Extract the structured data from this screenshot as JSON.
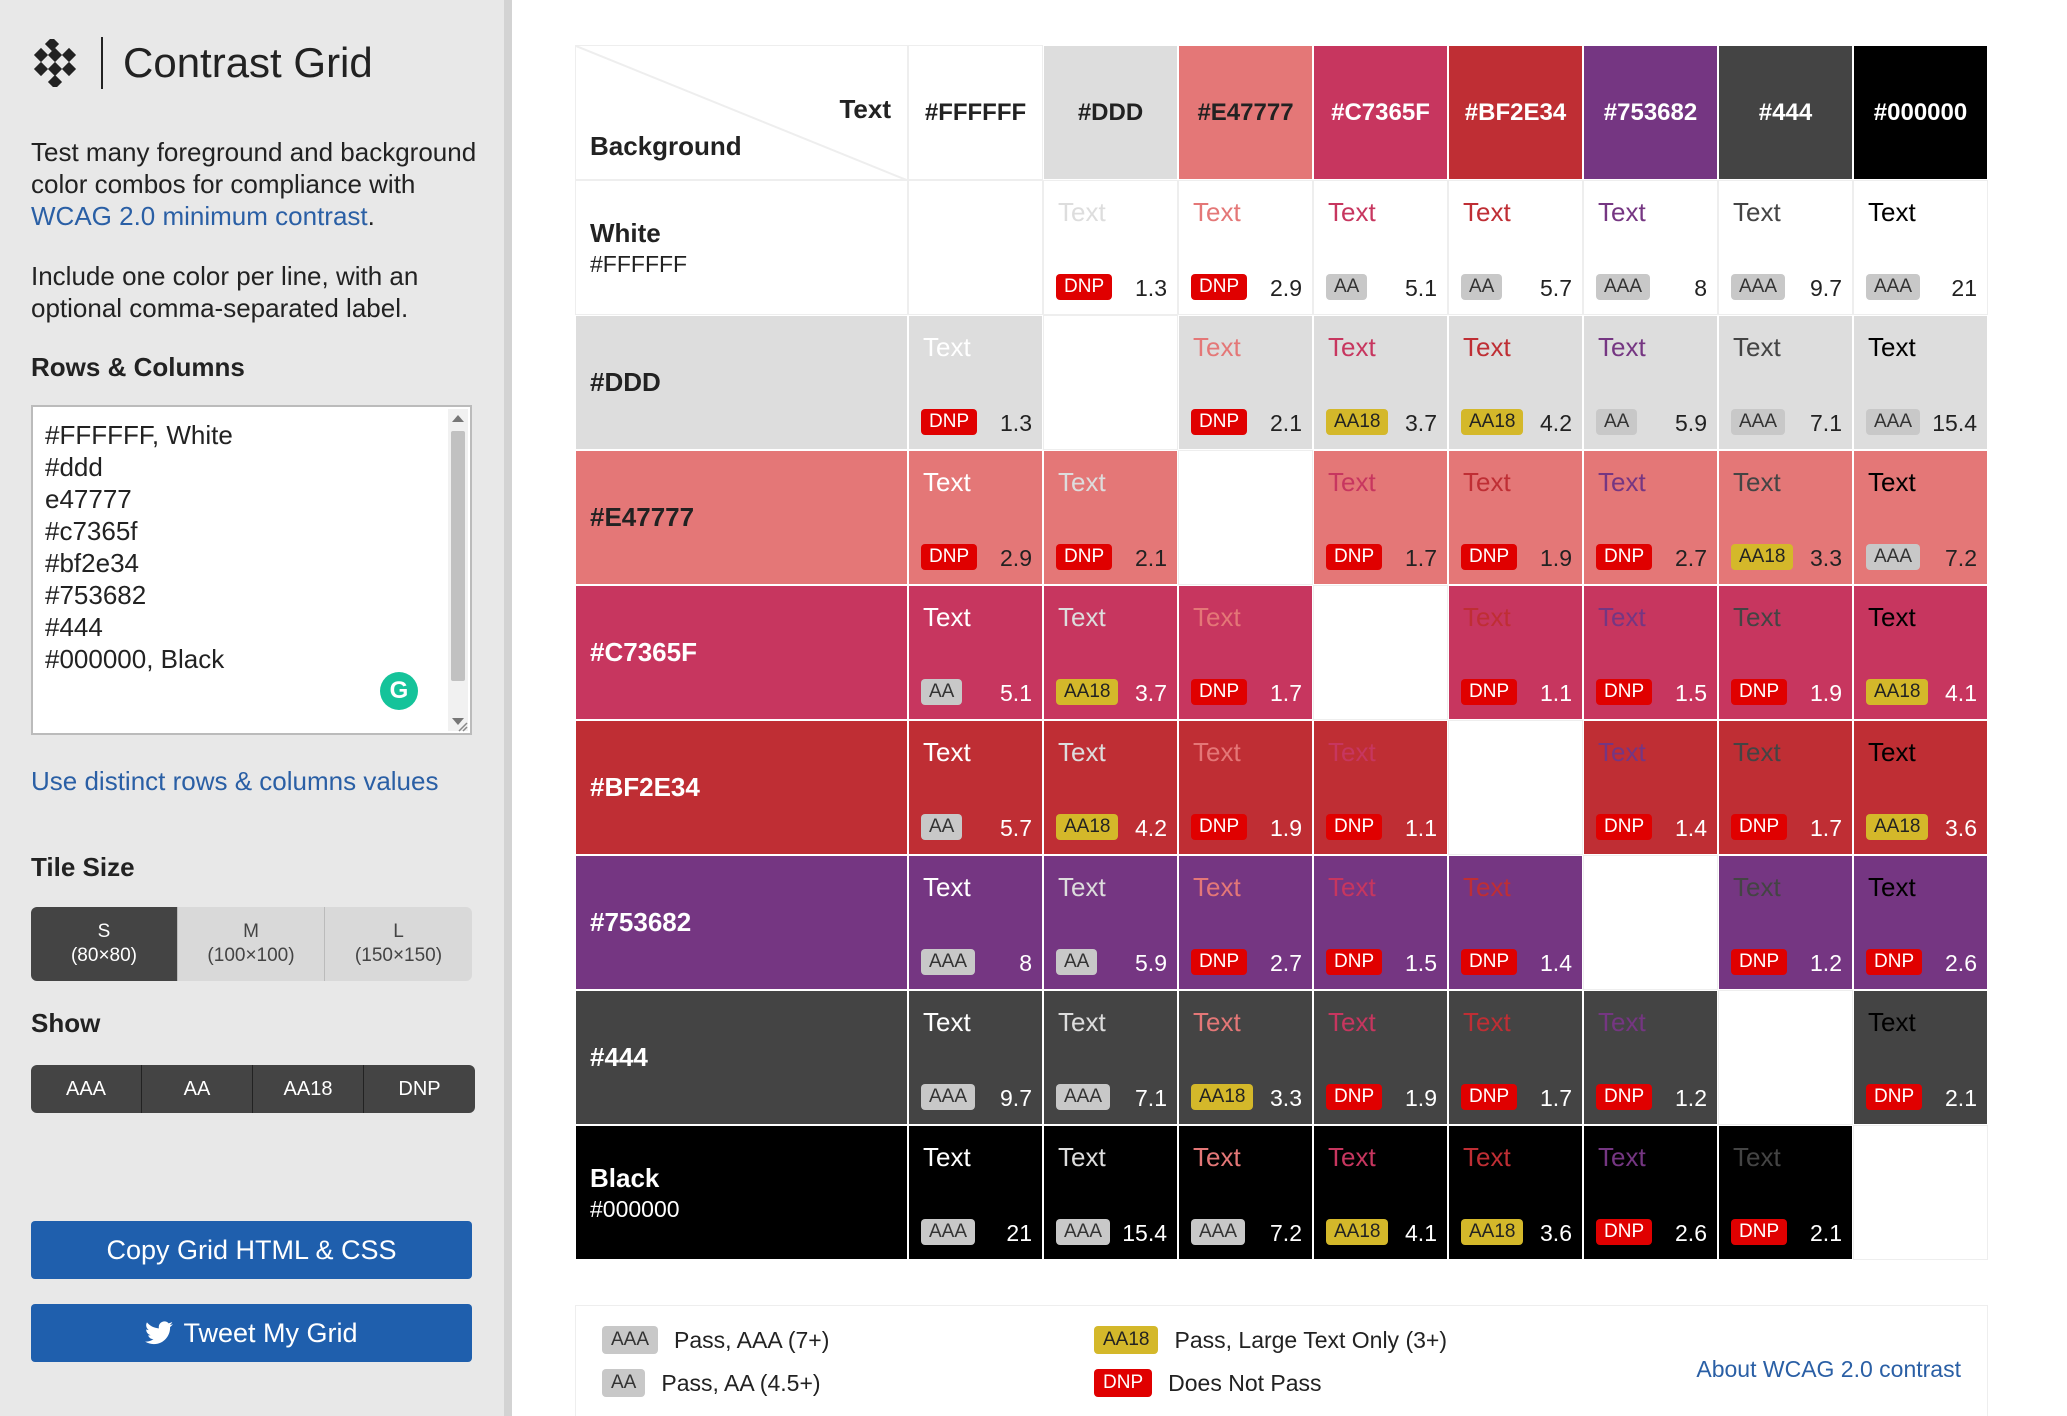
{
  "app": {
    "title": "Contrast Grid"
  },
  "sidebar": {
    "description_before": "Test many foreground and background color combos for compliance with ",
    "description_link": "WCAG 2.0 minimum contrast",
    "description_after": ".",
    "instructions": "Include one color per line, with an optional comma-separated label.",
    "rows_columns_label": "Rows & Columns",
    "color_input_value": "#FFFFFF, White\n#ddd\ne47777\n#c7365f\n#bf2e34\n#753682\n#444\n#000000, Black",
    "distinct_link": "Use distinct rows & columns values",
    "tile_size_label": "Tile Size",
    "tile_sizes": [
      {
        "name": "S",
        "dim": "(80×80)",
        "active": true
      },
      {
        "name": "M",
        "dim": "(100×100)",
        "active": false
      },
      {
        "name": "L",
        "dim": "(150×150)",
        "active": false
      }
    ],
    "show_label": "Show",
    "show_options": [
      "AAA",
      "AA",
      "AA18",
      "DNP"
    ],
    "copy_button": "Copy Grid HTML & CSS",
    "tweet_button": "Tweet My Grid"
  },
  "grid": {
    "corner_text": "Text",
    "corner_background": "Background",
    "sample_text": "Text",
    "columns": [
      {
        "label": "#FFFFFF",
        "color": "#FFFFFF",
        "label_color": "#222222"
      },
      {
        "label": "#DDD",
        "color": "#DDDDDD",
        "label_color": "#222222"
      },
      {
        "label": "#E47777",
        "color": "#E47777",
        "label_color": "#222222"
      },
      {
        "label": "#C7365F",
        "color": "#C7365F",
        "label_color": "#FFFFFF"
      },
      {
        "label": "#BF2E34",
        "color": "#BF2E34",
        "label_color": "#FFFFFF"
      },
      {
        "label": "#753682",
        "color": "#753682",
        "label_color": "#FFFFFF"
      },
      {
        "label": "#444",
        "color": "#444444",
        "label_color": "#FFFFFF"
      },
      {
        "label": "#000000",
        "color": "#000000",
        "label_color": "#FFFFFF"
      }
    ],
    "rows": [
      {
        "name": "White",
        "hex": "#FFFFFF",
        "color": "#FFFFFF",
        "label_color": "#222222",
        "cells": [
          null,
          {
            "b": "DNP",
            "r": "1.3"
          },
          {
            "b": "DNP",
            "r": "2.9"
          },
          {
            "b": "AA",
            "r": "5.1"
          },
          {
            "b": "AA",
            "r": "5.7"
          },
          {
            "b": "AAA",
            "r": "8"
          },
          {
            "b": "AAA",
            "r": "9.7"
          },
          {
            "b": "AAA",
            "r": "21"
          }
        ]
      },
      {
        "name": "#DDD",
        "hex": "",
        "color": "#DDDDDD",
        "label_color": "#222222",
        "cells": [
          {
            "b": "DNP",
            "r": "1.3"
          },
          null,
          {
            "b": "DNP",
            "r": "2.1"
          },
          {
            "b": "AA18",
            "r": "3.7"
          },
          {
            "b": "AA18",
            "r": "4.2"
          },
          {
            "b": "AA",
            "r": "5.9"
          },
          {
            "b": "AAA",
            "r": "7.1"
          },
          {
            "b": "AAA",
            "r": "15.4"
          }
        ]
      },
      {
        "name": "#E47777",
        "hex": "",
        "color": "#E47777",
        "label_color": "#222222",
        "cells": [
          {
            "b": "DNP",
            "r": "2.9"
          },
          {
            "b": "DNP",
            "r": "2.1"
          },
          null,
          {
            "b": "DNP",
            "r": "1.7"
          },
          {
            "b": "DNP",
            "r": "1.9"
          },
          {
            "b": "DNP",
            "r": "2.7"
          },
          {
            "b": "AA18",
            "r": "3.3"
          },
          {
            "b": "AAA",
            "r": "7.2"
          }
        ]
      },
      {
        "name": "#C7365F",
        "hex": "",
        "color": "#C7365F",
        "label_color": "#FFFFFF",
        "cells": [
          {
            "b": "AA",
            "r": "5.1"
          },
          {
            "b": "AA18",
            "r": "3.7"
          },
          {
            "b": "DNP",
            "r": "1.7"
          },
          null,
          {
            "b": "DNP",
            "r": "1.1"
          },
          {
            "b": "DNP",
            "r": "1.5"
          },
          {
            "b": "DNP",
            "r": "1.9"
          },
          {
            "b": "AA18",
            "r": "4.1"
          }
        ]
      },
      {
        "name": "#BF2E34",
        "hex": "",
        "color": "#BF2E34",
        "label_color": "#FFFFFF",
        "cells": [
          {
            "b": "AA",
            "r": "5.7"
          },
          {
            "b": "AA18",
            "r": "4.2"
          },
          {
            "b": "DNP",
            "r": "1.9"
          },
          {
            "b": "DNP",
            "r": "1.1"
          },
          null,
          {
            "b": "DNP",
            "r": "1.4"
          },
          {
            "b": "DNP",
            "r": "1.7"
          },
          {
            "b": "AA18",
            "r": "3.6"
          }
        ]
      },
      {
        "name": "#753682",
        "hex": "",
        "color": "#753682",
        "label_color": "#FFFFFF",
        "cells": [
          {
            "b": "AAA",
            "r": "8"
          },
          {
            "b": "AA",
            "r": "5.9"
          },
          {
            "b": "DNP",
            "r": "2.7"
          },
          {
            "b": "DNP",
            "r": "1.5"
          },
          {
            "b": "DNP",
            "r": "1.4"
          },
          null,
          {
            "b": "DNP",
            "r": "1.2"
          },
          {
            "b": "DNP",
            "r": "2.6"
          }
        ]
      },
      {
        "name": "#444",
        "hex": "",
        "color": "#444444",
        "label_color": "#FFFFFF",
        "cells": [
          {
            "b": "AAA",
            "r": "9.7"
          },
          {
            "b": "AAA",
            "r": "7.1"
          },
          {
            "b": "AA18",
            "r": "3.3"
          },
          {
            "b": "DNP",
            "r": "1.9"
          },
          {
            "b": "DNP",
            "r": "1.7"
          },
          {
            "b": "DNP",
            "r": "1.2"
          },
          null,
          {
            "b": "DNP",
            "r": "2.1"
          }
        ]
      },
      {
        "name": "Black",
        "hex": "#000000",
        "color": "#000000",
        "label_color": "#FFFFFF",
        "cells": [
          {
            "b": "AAA",
            "r": "21"
          },
          {
            "b": "AAA",
            "r": "15.4"
          },
          {
            "b": "AAA",
            "r": "7.2"
          },
          {
            "b": "AA18",
            "r": "4.1"
          },
          {
            "b": "AA18",
            "r": "3.6"
          },
          {
            "b": "DNP",
            "r": "2.6"
          },
          {
            "b": "DNP",
            "r": "2.1"
          },
          null
        ]
      }
    ]
  },
  "legend": {
    "items": [
      {
        "badge": "AAA",
        "text": "Pass, AAA (7+)"
      },
      {
        "badge": "AA",
        "text": "Pass, AA (4.5+)"
      },
      {
        "badge": "AA18",
        "text": "Pass, Large Text Only (3+)"
      },
      {
        "badge": "DNP",
        "text": "Does Not Pass"
      }
    ],
    "about_link": "About WCAG 2.0 contrast"
  },
  "colors": {
    "link": "#2a5fa5",
    "button": "#1f5fad",
    "dnp": "#e00000",
    "aa18": "#d4b82a",
    "aaa_aa": "#c8c8c8"
  }
}
